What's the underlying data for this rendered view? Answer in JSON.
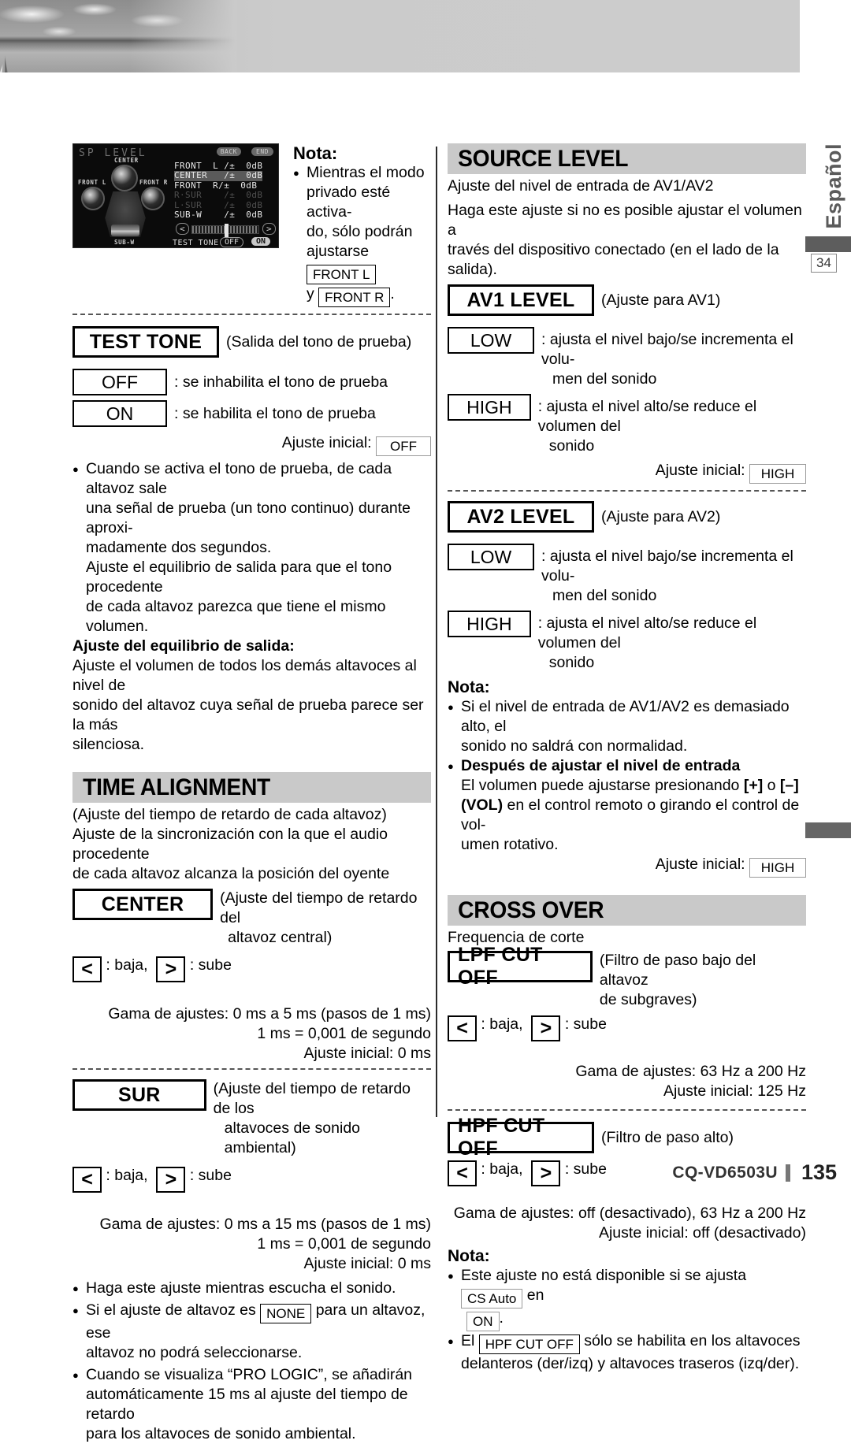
{
  "sidebar": {
    "language_tab": "Español",
    "page_ref": "34"
  },
  "device_screen": {
    "title": "SP LEVEL",
    "back_label": "BACK",
    "end_label": "END",
    "speaker_labels": [
      "CENTER",
      "FRONT L",
      "FRONT R",
      "SUB-W"
    ],
    "levels": [
      {
        "name": "FRONT  L /±",
        "value": "0dB",
        "state": "normal"
      },
      {
        "name": "CENTER   /±",
        "value": "0dB",
        "state": "highlighted"
      },
      {
        "name": "FRONT  R/±",
        "value": "0dB",
        "state": "normal"
      },
      {
        "name": "R·SUR    /±",
        "value": "0dB",
        "state": "dimmed"
      },
      {
        "name": "L·SUR    /±",
        "value": "0dB",
        "state": "dimmed"
      },
      {
        "name": "SUB-W    /±",
        "value": "0dB",
        "state": "normal"
      }
    ],
    "slider_left": "<",
    "slider_right": ">",
    "test_tone_label": "TEST TONE",
    "test_tone_off": "OFF",
    "test_tone_on": "ON"
  },
  "nota_top": {
    "heading": "Nota:",
    "line1": "Mientras el modo",
    "line2": "privado esté activa-",
    "line3": "do, sólo podrán",
    "line4": "ajustarse",
    "key1": "FRONT L",
    "line5": "y",
    "key2": "FRONT R",
    "period": "."
  },
  "test_tone": {
    "key": "TEST TONE",
    "caption": "(Salida del tono de prueba)",
    "options": [
      {
        "label": "OFF",
        "desc": ": se inhabilita el tono de prueba"
      },
      {
        "label": "ON",
        "desc": ": se habilita el tono de prueba"
      }
    ],
    "initial_label": "Ajuste inicial:",
    "initial_value": "OFF",
    "bullet1_l1": "Cuando se activa el tono de prueba, de cada altavoz sale",
    "bullet1_l2": "una señal de prueba (un tono continuo) durante aproxi-",
    "bullet1_l3": "madamente dos segundos.",
    "bullet1_l4": "Ajuste el equilibrio de salida para que el tono procedente",
    "bullet1_l5": "de cada altavoz parezca que tiene el mismo volumen.",
    "balance_heading": "Ajuste del equilibrio de salida:",
    "balance_l1": "Ajuste el volumen de todos los demás altavoces al nivel de",
    "balance_l2": "sonido del altavoz cuya señal de prueba parece ser la más",
    "balance_l3": "silenciosa."
  },
  "time_alignment": {
    "heading": "TIME ALIGNMENT",
    "subtitle": "(Ajuste del tiempo de retardo de cada altavoz)",
    "desc_l1": "Ajuste de la sincronización con la que el audio procedente",
    "desc_l2": "de cada altavoz alcanza la posición del oyente",
    "center": {
      "key": "CENTER",
      "caption_l1": "(Ajuste del tiempo de retardo del",
      "caption_l2": "altavoz central)",
      "arrow_left": "<",
      "arrow_left_desc": ": baja,",
      "arrow_right": ">",
      "arrow_right_desc": ": sube",
      "range": "Gama de ajustes: 0 ms a 5 ms (pasos de 1 ms)",
      "note": "1 ms = 0,001 de segundo",
      "initial": "Ajuste inicial: 0 ms"
    },
    "sur": {
      "key": "SUR",
      "caption_l1": "(Ajuste del tiempo de retardo de los",
      "caption_l2": "altavoces de sonido ambiental)",
      "arrow_left": "<",
      "arrow_left_desc": ": baja,",
      "arrow_right": ">",
      "arrow_right_desc": ": sube",
      "range": "Gama de ajustes: 0 ms a 15 ms (pasos de 1 ms)",
      "note": "1 ms = 0,001 de segundo",
      "initial": "Ajuste inicial: 0 ms"
    },
    "bullet1": "Haga este ajuste mientras escucha el sonido.",
    "bullet2_a": "Si el ajuste de altavoz es",
    "bullet2_key": "NONE",
    "bullet2_b": "para un altavoz, ese",
    "bullet2_l2": "altavoz no podrá seleccionarse.",
    "bullet3_l1": "Cuando se visualiza “PRO LOGIC”, se añadirán",
    "bullet3_l2": "automáticamente 15 ms al ajuste del tiempo de retardo",
    "bullet3_l3": "para los altavoces de sonido ambiental."
  },
  "source_level": {
    "heading": "SOURCE LEVEL",
    "subtitle": "Ajuste del nivel de entrada de AV1/AV2",
    "desc_l1": "Haga este ajuste si no es posible ajustar el volumen a",
    "desc_l2": "través del dispositivo conectado (en el lado de la salida).",
    "av1": {
      "key": "AV1 LEVEL",
      "caption": "(Ajuste para AV1)",
      "low_label": "LOW",
      "low_desc_l1": ": ajusta el nivel bajo/se incrementa el volu-",
      "low_desc_l2": "men del sonido",
      "high_label": "HIGH",
      "high_desc_l1": ": ajusta el nivel alto/se reduce el volumen del",
      "high_desc_l2": "sonido",
      "initial_label": "Ajuste inicial:",
      "initial_value": "HIGH"
    },
    "av2": {
      "key": "AV2 LEVEL",
      "caption": "(Ajuste para AV2)",
      "low_label": "LOW",
      "low_desc_l1": ": ajusta el nivel bajo/se incrementa el volu-",
      "low_desc_l2": "men del sonido",
      "high_label": "HIGH",
      "high_desc_l1": ": ajusta el nivel alto/se reduce el volumen del",
      "high_desc_l2": "sonido",
      "initial_label": "Ajuste inicial:",
      "initial_value": "HIGH"
    },
    "nota": {
      "heading": "Nota:",
      "b1_l1": "Si el nivel de entrada de AV1/AV2 es demasiado alto, el",
      "b1_l2": "sonido no saldrá con normalidad.",
      "b2_heading": "Después de ajustar el nivel de entrada",
      "b2_l1_a": "El volumen puede ajustarse presionando",
      "b2_plus": "[+]",
      "b2_or": "o",
      "b2_minus": "[–]",
      "b2_vol": "(VOL)",
      "b2_l2_b": "en el control remoto o girando el control de vol-",
      "b2_l3": "umen rotativo."
    }
  },
  "cross_over": {
    "heading": "CROSS OVER",
    "subtitle": "Frequencia de corte",
    "lpf": {
      "key": "LPF CUT OFF",
      "caption_l1": "(Filtro de paso bajo del altavoz",
      "caption_l2": "de subgraves)",
      "arrow_left": "<",
      "arrow_left_desc": ": baja,",
      "arrow_right": ">",
      "arrow_right_desc": ": sube",
      "range": "Gama de ajustes: 63 Hz a 200 Hz",
      "initial": "Ajuste inicial: 125 Hz"
    },
    "hpf": {
      "key": "HPF CUT OFF",
      "caption": "(Filtro de paso alto)",
      "arrow_left": "<",
      "arrow_left_desc": ": baja,",
      "arrow_right": ">",
      "arrow_right_desc": ": sube",
      "range": "Gama de ajustes: off (desactivado), 63 Hz a 200 Hz",
      "initial": "Ajuste inicial: off (desactivado)"
    },
    "nota": {
      "heading": "Nota:",
      "b1_a": "Este ajuste no está disponible si se ajusta",
      "b1_key": "CS Auto",
      "b1_b": "en",
      "b1_key2": "ON",
      "b1_period": ".",
      "b2_a": "El",
      "b2_key": "HPF CUT OFF",
      "b2_b": "sólo se habilita en los altavoces",
      "b2_l2": "delanteros (der/izq) y altavoces traseros (izq/der)."
    }
  },
  "footer": {
    "model": "CQ-VD6503U",
    "page_number": "135"
  }
}
